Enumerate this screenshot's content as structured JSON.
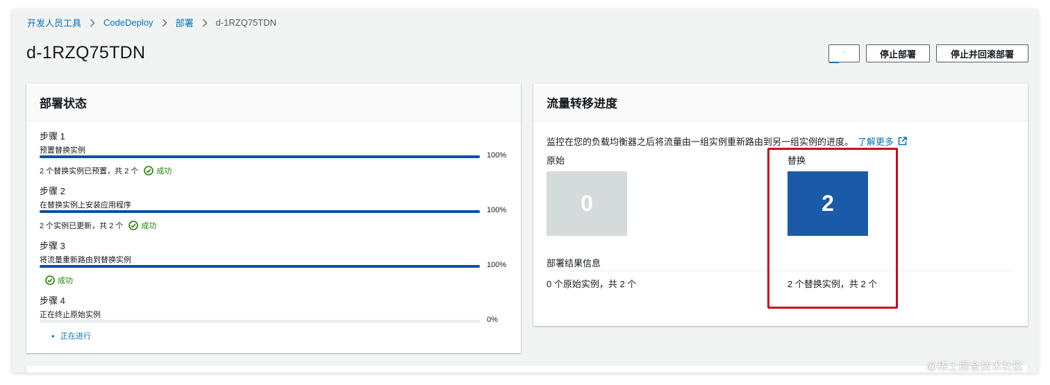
{
  "breadcrumb": {
    "items": [
      "开发人员工具",
      "CodeDeploy",
      "部署"
    ],
    "current": "d-1RZQ75TDN"
  },
  "page_title": "d-1RZQ75TDN",
  "actions": {
    "small_button_label": "‘",
    "stop_label": "停止部署",
    "stop_rollback_label": "停止并回滚部署"
  },
  "deployment_status": {
    "title": "部署状态",
    "steps": [
      {
        "title": "步骤 1",
        "desc": "预置替换实例",
        "progress_pct": 100,
        "progress_label": "100%",
        "status_text": "2 个替换实例已预置，共 2 个",
        "result": "成功"
      },
      {
        "title": "步骤 2",
        "desc": "在替换实例上安装应用程序",
        "progress_pct": 100,
        "progress_label": "100%",
        "status_text": "2 个实例已更新，共 2 个",
        "result": "成功"
      },
      {
        "title": "步骤 3",
        "desc": "将流量重新路由到替换实例",
        "progress_pct": 100,
        "progress_label": "100%",
        "status_text": "",
        "result": "成功"
      },
      {
        "title": "步骤 4",
        "desc": "正在终止原始实例",
        "progress_pct": 0,
        "progress_label": "0%",
        "status_text": "",
        "result": "正在进行"
      }
    ]
  },
  "traffic_shift": {
    "title": "流量转移进度",
    "description": "监控在您的负载均衡器之后将流量由一组实例重新路由到另一组实例的进度。",
    "learn_more": "了解更多",
    "original_label": "原始",
    "original_count": "0",
    "replacement_label": "替换",
    "replacement_count": "2",
    "result_title": "部署结果信息",
    "original_result": "0 个原始实例，共 2 个",
    "replacement_result": "2 个替换实例，共 2 个"
  },
  "colors": {
    "link": "#0073bb",
    "success": "#1d8102",
    "progress": "#0f4fa3",
    "replacement_tile": "#1a5aa9",
    "original_tile": "#d5dbdb",
    "highlight": "#d0021b"
  },
  "watermark": "@稀土掘金技术社区"
}
